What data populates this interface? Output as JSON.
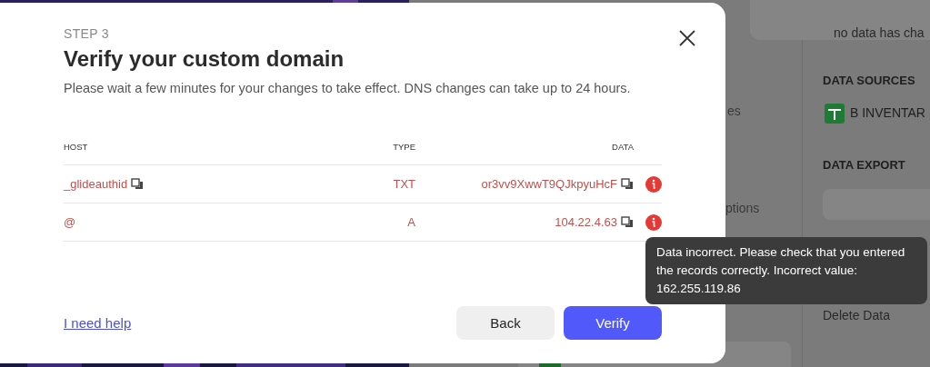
{
  "background": {
    "middle_texts": [
      "es",
      "ptions"
    ],
    "notice": "no data has cha",
    "sections": [
      {
        "title": "DATA SOURCES",
        "item": "B INVENTAR"
      },
      {
        "title": "DATA EXPORT"
      }
    ],
    "delete_label": "Delete Data"
  },
  "dialog": {
    "step": "STEP 3",
    "title": "Verify your custom domain",
    "description": "Please wait a few minutes for your changes to take effect. DNS changes can take up to 24 hours.",
    "table": {
      "columns": [
        "HOST",
        "TYPE",
        "DATA"
      ],
      "rows": [
        {
          "host": "_glideauthid",
          "type": "TXT",
          "data": "or3vv9XwwT9QJkpyuHcF",
          "error": true
        },
        {
          "host": "@",
          "type": "A",
          "data": "104.22.4.63",
          "error": true
        }
      ]
    },
    "help_link": "I need help",
    "buttons": [
      {
        "label": "Back",
        "kind": "secondary"
      },
      {
        "label": "Verify",
        "kind": "primary"
      }
    ]
  },
  "tooltip": "Data incorrect. Please check that you entered the records correctly. Incorrect value: 162.255.119.86"
}
